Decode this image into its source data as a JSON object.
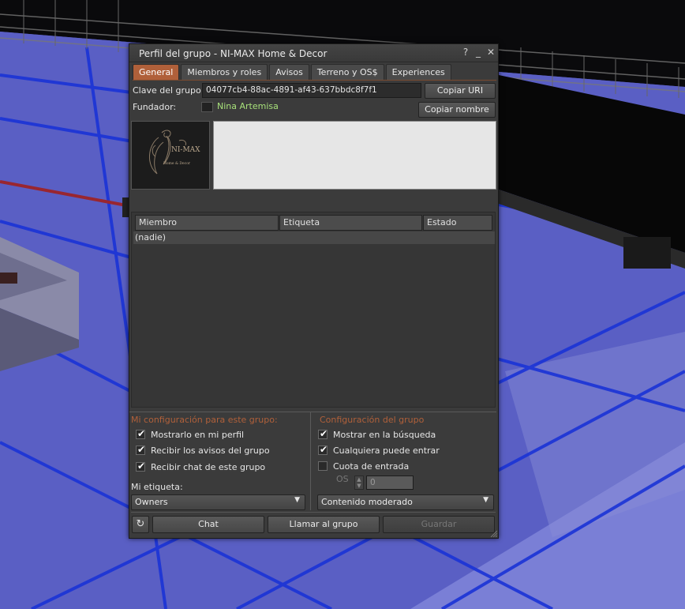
{
  "window": {
    "title": "Perfil del grupo - NI-MAX Home & Decor",
    "help_icon": "?",
    "minimize_icon": "_",
    "close_icon": "✕"
  },
  "tabs": [
    {
      "label": "General",
      "active": true
    },
    {
      "label": "Miembros y roles",
      "active": false
    },
    {
      "label": "Avisos",
      "active": false
    },
    {
      "label": "Terreno y OS$",
      "active": false
    },
    {
      "label": "Experiences",
      "active": false
    }
  ],
  "group_key": {
    "label": "Clave del grupo:",
    "value": "04077cb4-88ac-4891-af43-637bbdc8f7f1",
    "copy_button": "Copiar URI"
  },
  "founder": {
    "label": "Fundador:",
    "name": "Nina Artemisa",
    "copy_button": "Copiar nombre"
  },
  "insignia": {
    "logo_text": "NI-MAX",
    "logo_subtext": "Home & Decor"
  },
  "members_table": {
    "columns": [
      "Miembro",
      "Etiqueta",
      "Estado"
    ],
    "empty_text": "(nadie)"
  },
  "my_settings": {
    "title": "Mi configuración para este grupo:",
    "options": [
      {
        "label": "Mostrarlo en mi perfil",
        "checked": true
      },
      {
        "label": "Recibir los avisos del grupo",
        "checked": true
      },
      {
        "label": "Recibir chat de este grupo",
        "checked": true
      }
    ],
    "tag_label": "Mi etiqueta:",
    "tag_value": "Owners"
  },
  "group_settings": {
    "title": "Configuración del grupo",
    "options": [
      {
        "label": "Mostrar en la búsqueda",
        "checked": true
      },
      {
        "label": "Cualquiera puede entrar",
        "checked": true
      },
      {
        "label": "Cuota de entrada",
        "checked": false
      }
    ],
    "fee_currency": "OS",
    "fee_value": "0",
    "maturity_value": "Contenido moderado"
  },
  "footer": {
    "refresh_icon": "refresh-icon",
    "chat_button": "Chat",
    "call_button": "Llamar al grupo",
    "save_button": "Guardar"
  },
  "colors": {
    "accent": "#b0603a",
    "founder_name": "#a7e07a",
    "panel": "#3b3b3b"
  }
}
